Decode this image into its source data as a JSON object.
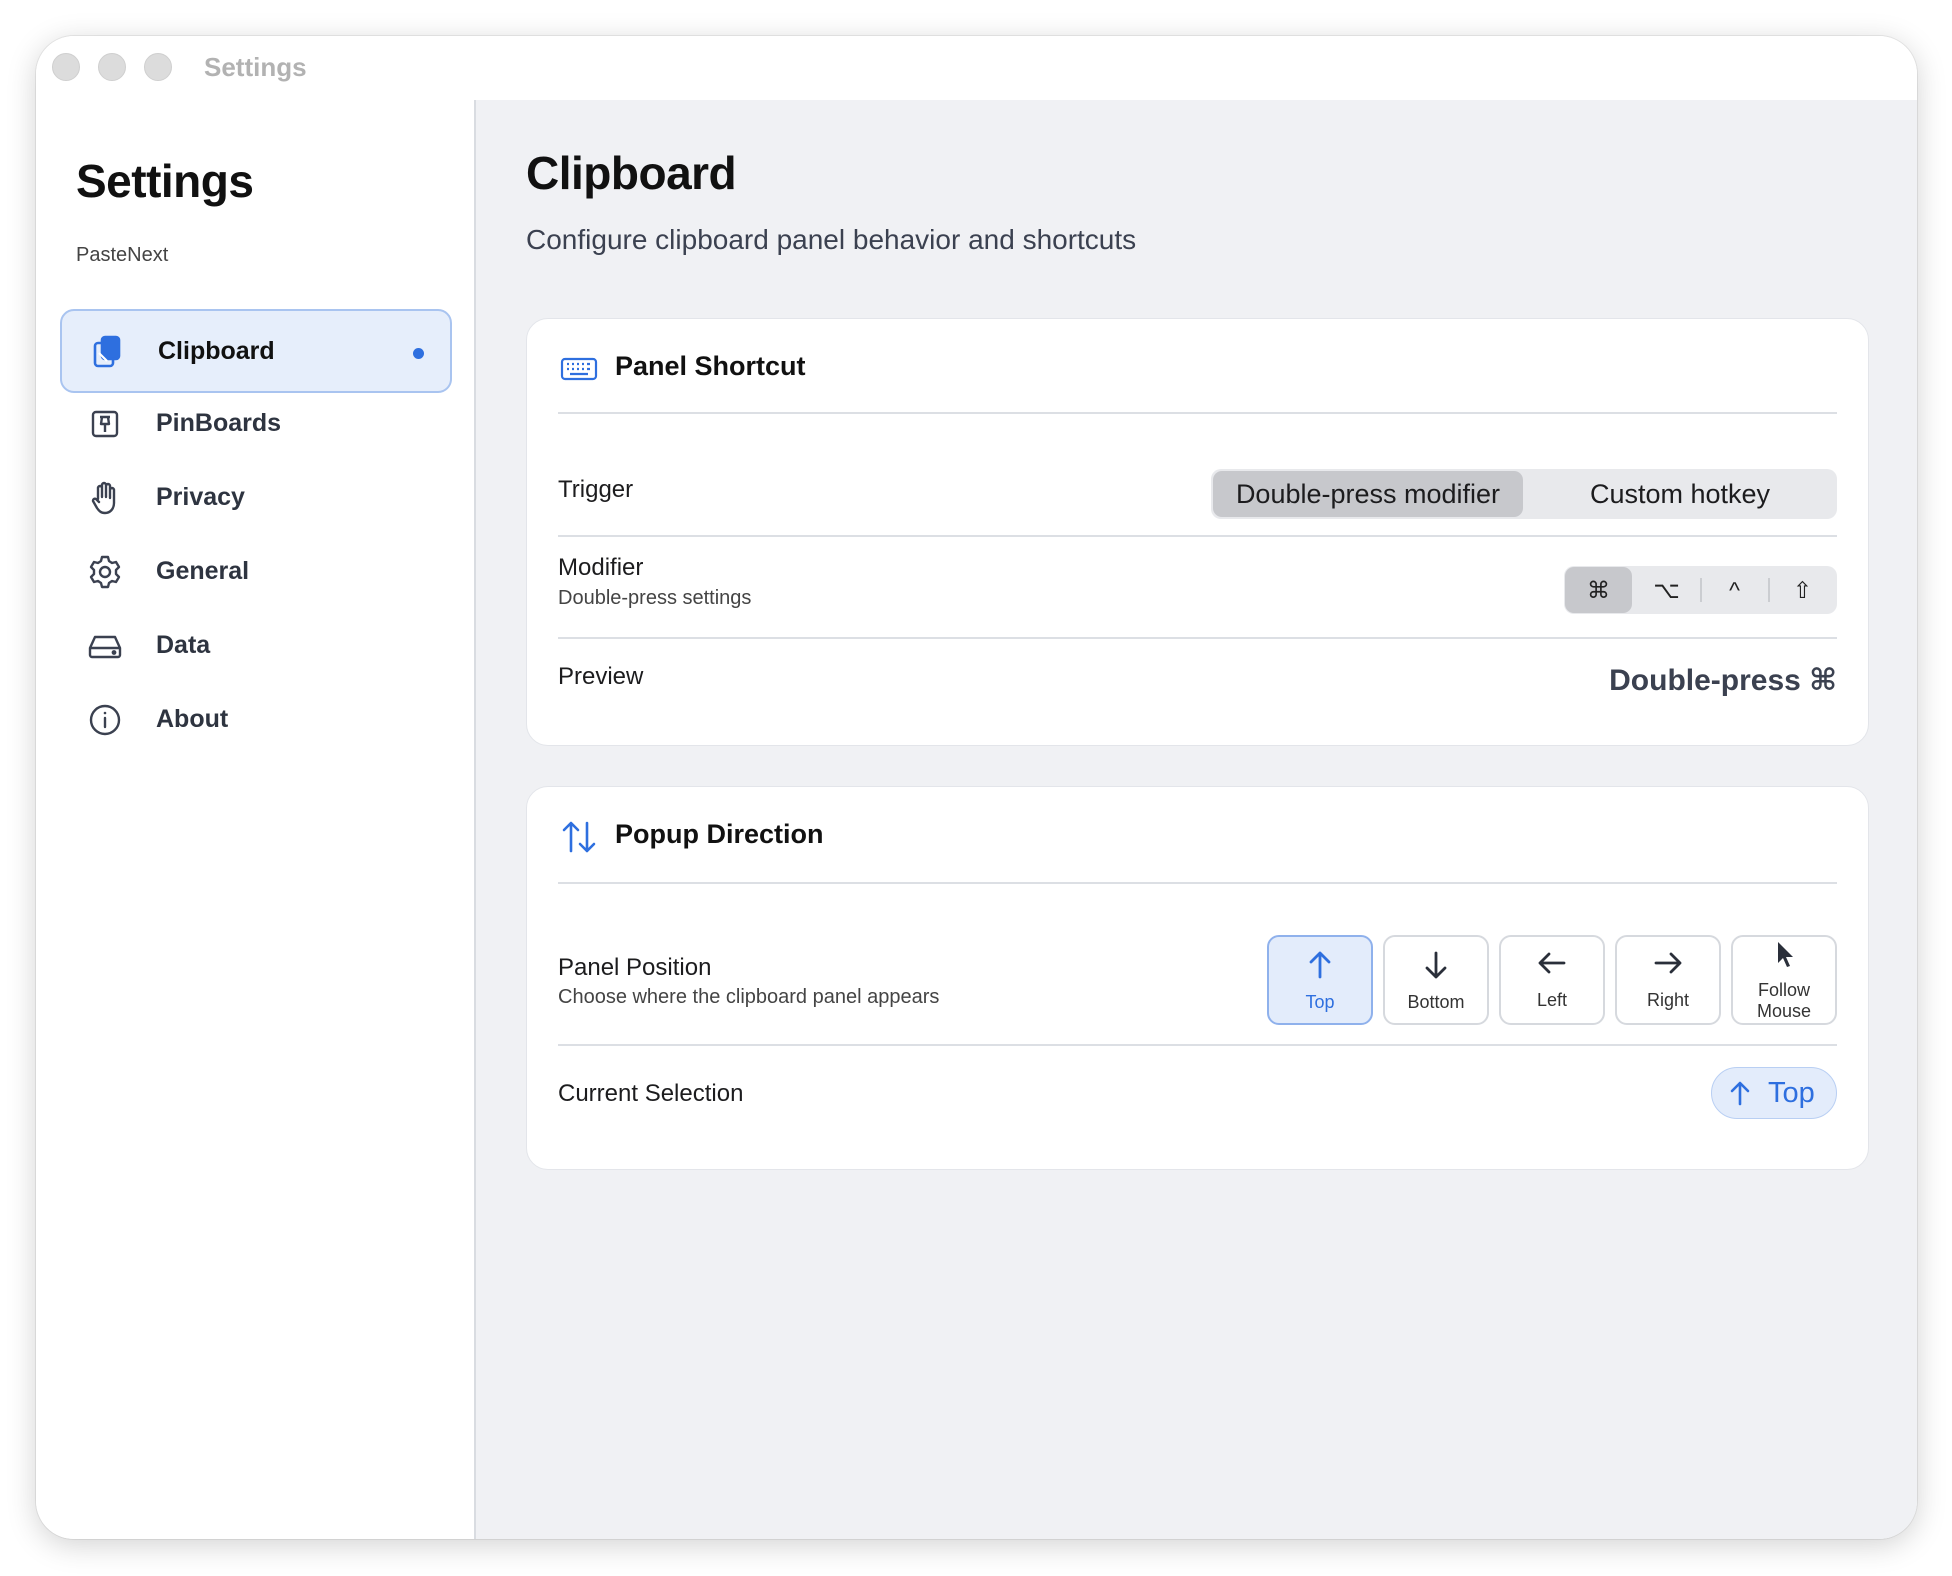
{
  "window": {
    "title": "Settings"
  },
  "sidebar": {
    "title": "Settings",
    "subtitle": "PasteNext",
    "items": [
      {
        "label": "Clipboard",
        "icon": "clipboard-icon",
        "active": true
      },
      {
        "label": "PinBoards",
        "icon": "pin-icon"
      },
      {
        "label": "Privacy",
        "icon": "hand-icon"
      },
      {
        "label": "General",
        "icon": "gear-icon"
      },
      {
        "label": "Data",
        "icon": "drive-icon"
      },
      {
        "label": "About",
        "icon": "info-icon"
      }
    ]
  },
  "main": {
    "title": "Clipboard",
    "subtitle": "Configure clipboard panel behavior and shortcuts"
  },
  "panel_shortcut": {
    "title": "Panel Shortcut",
    "trigger_label": "Trigger",
    "trigger_options": [
      "Double-press modifier",
      "Custom hotkey"
    ],
    "trigger_selected": "Double-press modifier",
    "modifier_label": "Modifier",
    "modifier_sub": "Double-press settings",
    "modifier_keys": [
      "⌘",
      "⌥",
      "^",
      "⇧"
    ],
    "modifier_selected": "⌘",
    "preview_label": "Preview",
    "preview_value": "Double-press ⌘"
  },
  "popup_direction": {
    "title": "Popup Direction",
    "position_label": "Panel Position",
    "position_sub": "Choose where the clipboard panel appears",
    "positions": [
      "Top",
      "Bottom",
      "Left",
      "Right",
      "Follow Mouse"
    ],
    "positions_line2": [
      "",
      "",
      "",
      "",
      "Mouse"
    ],
    "positions_line1": [
      "Top",
      "Bottom",
      "Left",
      "Right",
      "Follow"
    ],
    "selected": "Top",
    "current_label": "Current Selection",
    "current_value": "Top"
  },
  "colors": {
    "accent": "#2e6fdf",
    "sidebar_active_bg": "#e6eefb",
    "main_bg": "#f0f1f4"
  }
}
